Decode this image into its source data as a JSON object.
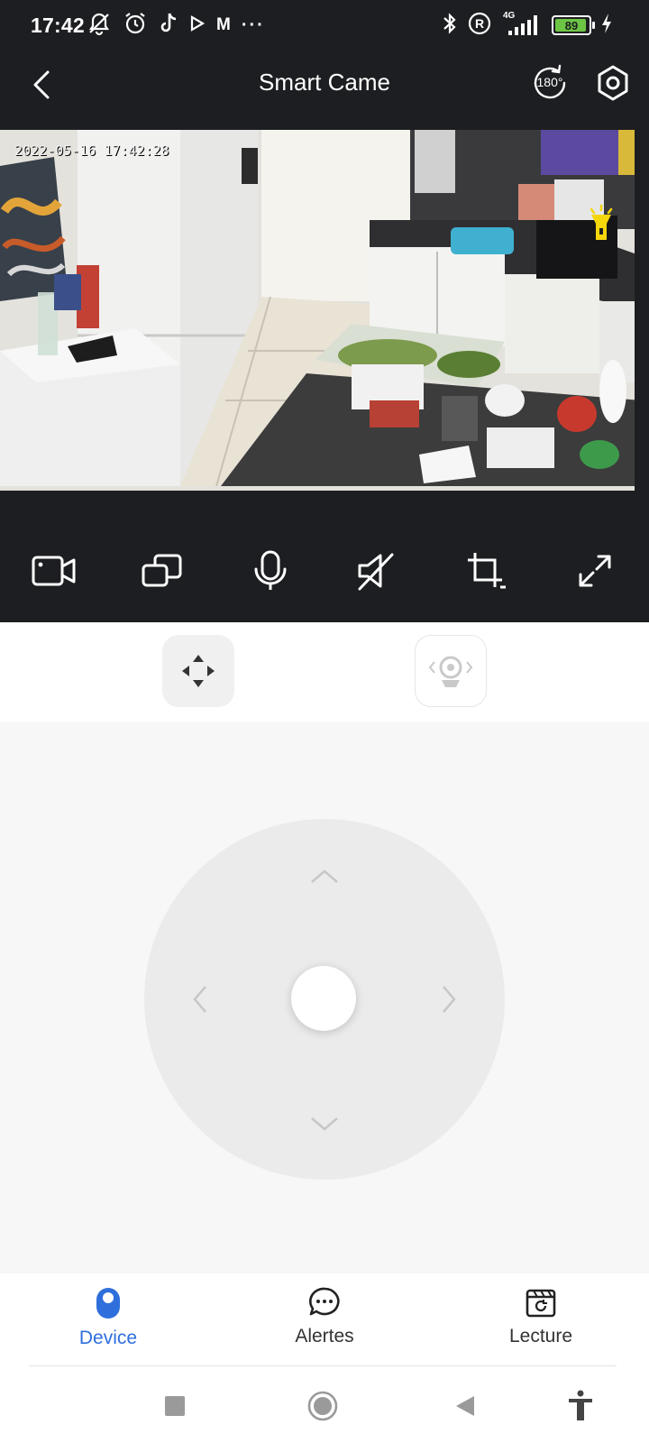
{
  "status_bar": {
    "time": "17:42",
    "left_icons": [
      "bell-off-icon",
      "alarm-icon",
      "tiktok-icon",
      "play-icon"
    ],
    "m_label": "M",
    "more_label": "···",
    "network_label": "4G",
    "battery_level": "89"
  },
  "header": {
    "title": "Smart Came",
    "rotate_label": "180°"
  },
  "camera_feed": {
    "timestamp": "2022-05-16 17:42:28"
  },
  "controls": [
    "record-video-icon",
    "multi-view-icon",
    "microphone-icon",
    "mute-icon",
    "crop-icon",
    "fullscreen-icon"
  ],
  "bottom_nav": {
    "items": [
      {
        "label": "Device",
        "active": true
      },
      {
        "label": "Alertes",
        "active": false
      },
      {
        "label": "Lecture",
        "active": false
      }
    ]
  },
  "colors": {
    "dark_bg": "#1d1e21",
    "accent": "#2f6fdc",
    "battery_fill": "#6cc644",
    "flash_yellow": "#f5d60a"
  }
}
